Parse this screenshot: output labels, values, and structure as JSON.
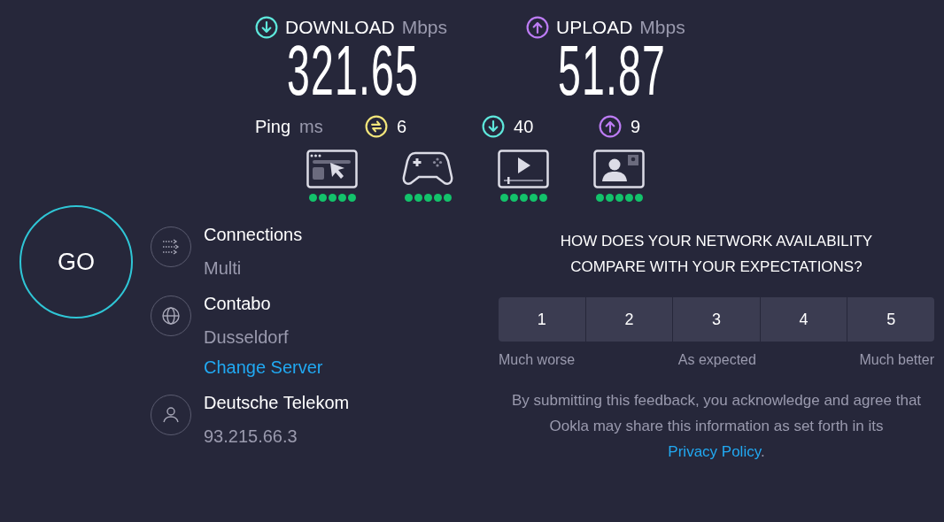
{
  "download": {
    "label": "DOWNLOAD",
    "unit": "Mbps",
    "value": "321.65"
  },
  "upload": {
    "label": "UPLOAD",
    "unit": "Mbps",
    "value": "51.87"
  },
  "ping": {
    "label": "Ping",
    "unit": "ms",
    "items": [
      {
        "kind": "idle",
        "value": "6"
      },
      {
        "kind": "download",
        "value": "40"
      },
      {
        "kind": "upload",
        "value": "9"
      }
    ]
  },
  "quality": [
    {
      "kind": "browsing",
      "stars": 5
    },
    {
      "kind": "gaming",
      "stars": 5
    },
    {
      "kind": "video",
      "stars": 5
    },
    {
      "kind": "video_call",
      "stars": 5
    }
  ],
  "go": "GO",
  "info": [
    {
      "kind": "connections",
      "title": "Connections",
      "detail": "Multi"
    },
    {
      "kind": "server",
      "title": "Contabo",
      "detail": "Dusseldorf",
      "link": "Change Server"
    },
    {
      "kind": "provider",
      "title": "Deutsche Telekom",
      "detail": "93.215.66.3"
    }
  ],
  "feedback": {
    "question": "HOW DOES YOUR NETWORK AVAILABILITY COMPARE WITH YOUR EXPECTATIONS?",
    "options": [
      {
        "label": "1",
        "selected": false
      },
      {
        "label": "2",
        "selected": false
      },
      {
        "label": "3",
        "selected": false
      },
      {
        "label": "4",
        "selected": false
      },
      {
        "label": "5",
        "selected": false
      }
    ],
    "scale_labels": [
      "Much worse",
      "As expected",
      "Much better"
    ],
    "disclaimer": "By submitting this feedback, you acknowledge and agree that Ookla may share this information as set forth in its",
    "link": "Privacy Policy",
    "end": "."
  }
}
